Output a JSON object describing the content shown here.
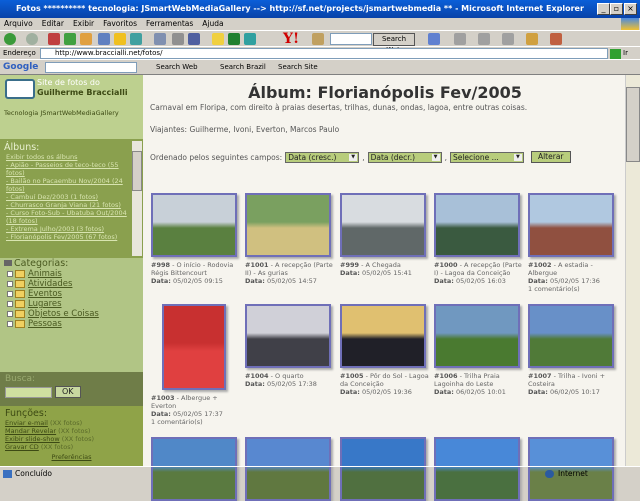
{
  "window": {
    "title": "Fotos ********** tecnologia: JSmartWebMediaGallery --> http://sf.net/projects/jsmartwebmedia ** - Microsoft Internet Explorer"
  },
  "menu": [
    "Arquivo",
    "Editar",
    "Exibir",
    "Favoritos",
    "Ferramentas",
    "Ajuda"
  ],
  "toolbar": {
    "search_web": "Search Web"
  },
  "address": {
    "label": "Endereço",
    "url": "http://www.braccialli.net/fotos/",
    "go": "Ir"
  },
  "google": {
    "logo": "Google",
    "search_web": "Search Web",
    "search_brazil": "Search Brazil",
    "search_site": "Search Site"
  },
  "sidebar": {
    "site_line1": "Site de fotos do",
    "site_line2": "Guilherme Braccialli",
    "tech_label": "Tecnologia",
    "tech_link": "JSmartWebMediaGallery",
    "albums_title": "Álbuns:",
    "albums": [
      "Exibir todos os álbuns",
      "- Apião - Passeios de teco-teco (55 fotos)",
      "- Bailão no Pacaembu Nov/2004 (24 fotos)",
      "- Cambuí Dez/2003 (1 fotos)",
      "- Churrasco Granja Viana (21 fotos)",
      "- Curso Foto-Sub - Ubatuba Out/2004 (18 fotos)",
      "- Extrema Julho/2003 (3 fotos)",
      "- Florianópolis Fev/2005 (67 fotos)"
    ],
    "categories_title": "Categorias:",
    "categories": [
      "Animais",
      "Atividades",
      "Eventos",
      "Lugares",
      "Objetos e Coisas",
      "Pessoas"
    ],
    "search_title": "Busca:",
    "search_ok": "OK",
    "functions_title": "Funções:",
    "functions": [
      {
        "link": "Enviar e-mail",
        "count": "(XX fotos)"
      },
      {
        "link": "Mandar Revelar",
        "count": "(XX fotos)"
      },
      {
        "link": "Exibir slide-show",
        "count": "(XX fotos)"
      },
      {
        "link": "Gravar CD",
        "count": "(XX fotos)"
      }
    ],
    "preferences": "Preferências"
  },
  "main": {
    "title": "Álbum: Florianópolis Fev/2005",
    "description": "Carnaval em Floripa, com direito à praias desertas, trilhas, dunas, ondas, lagoa, entre outras coisas.",
    "travelers": "Viajantes: Guilherme, Ivoni, Everton, Marcos Paulo",
    "sort_label": "Ordenado pelos seguintes campos:",
    "sort1": "Data (cresc.)",
    "sort2": "Data (decr.)",
    "sort3": "Selecione ...",
    "sort_button": "Alterar",
    "sep": ",",
    "date_label": "Data:",
    "photos": [
      {
        "id": "#998",
        "title": "O início - Rodovia Régis Bittencourt",
        "date": "05/02/05 09:15",
        "comments": "",
        "colors": [
          "#c8d0d8",
          "#5a8040"
        ]
      },
      {
        "id": "#1001",
        "title": "A recepção (Parte II) - As gurias",
        "date": "05/02/05 14:57",
        "comments": "",
        "colors": [
          "#7aa060",
          "#d0c080"
        ]
      },
      {
        "id": "#999",
        "title": "A Chegada",
        "date": "05/02/05 15:41",
        "comments": "",
        "colors": [
          "#d8dce0",
          "#606868"
        ]
      },
      {
        "id": "#1000",
        "title": "A recepção (Parte I) - Lagoa da Conceição",
        "date": "05/02/05 16:03",
        "comments": "",
        "colors": [
          "#a8c0d8",
          "#3a5a40"
        ]
      },
      {
        "id": "#1002",
        "title": "A estadia - Albergue",
        "date": "05/02/05 17:36",
        "comments": "1 comentário(s)",
        "colors": [
          "#b0c8e0",
          "#905040"
        ]
      },
      {
        "id": "#1003",
        "title": "Albergue + Everton",
        "date": "05/02/05 17:37",
        "comments": "1 comentário(s)",
        "colors": [
          "#c83030",
          "#e04040"
        ]
      },
      {
        "id": "#1004",
        "title": "O quarto",
        "date": "05/02/05 17:38",
        "comments": "",
        "colors": [
          "#d0d0d8",
          "#404048"
        ]
      },
      {
        "id": "#1005",
        "title": "Pôr do Sol - Lagoa da Conceição",
        "date": "05/02/05 19:36",
        "comments": "",
        "colors": [
          "#e0c070",
          "#202028"
        ]
      },
      {
        "id": "#1006",
        "title": "Trilha Praia Lagoinha do Leste",
        "date": "06/02/05 10:01",
        "comments": "",
        "colors": [
          "#7098c0",
          "#4a7a30"
        ]
      },
      {
        "id": "#1007",
        "title": "Trilha - Ivoni + Costeira",
        "date": "06/02/05 10:17",
        "comments": "",
        "colors": [
          "#6890c8",
          "#507a38"
        ]
      },
      {
        "id": "",
        "title": "",
        "date": "",
        "comments": "",
        "colors": [
          "#5088c8",
          "#5a7a40"
        ]
      },
      {
        "id": "",
        "title": "",
        "date": "",
        "comments": "",
        "colors": [
          "#5888d0",
          "#607840"
        ]
      },
      {
        "id": "",
        "title": "",
        "date": "",
        "comments": "",
        "colors": [
          "#3878c8",
          "#507040"
        ]
      },
      {
        "id": "",
        "title": "",
        "date": "",
        "comments": "",
        "colors": [
          "#4888d8",
          "#4a7040"
        ]
      },
      {
        "id": "",
        "title": "",
        "date": "",
        "comments": "",
        "colors": [
          "#5890d8",
          "#6a8048"
        ]
      }
    ]
  },
  "status": {
    "text": "Concluído",
    "zone": "Internet"
  }
}
